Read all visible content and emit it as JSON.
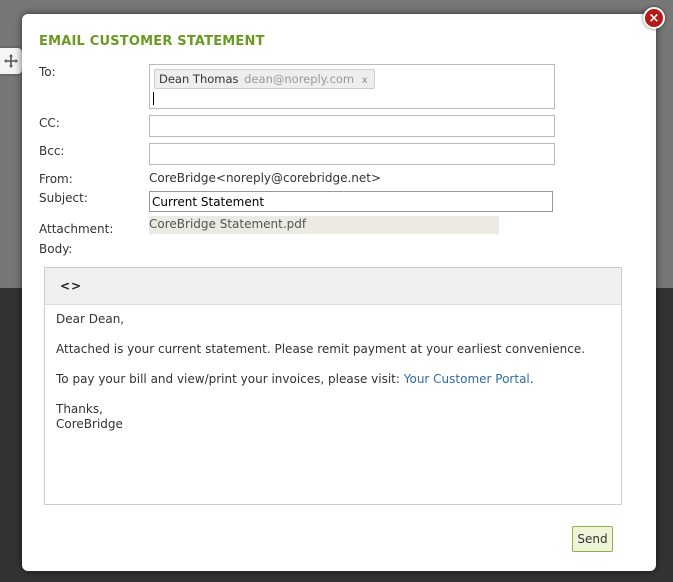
{
  "dialog": {
    "title": "EMAIL CUSTOMER STATEMENT",
    "close_symbol": "×"
  },
  "fields": {
    "to_label": "To:",
    "cc_label": "CC:",
    "bcc_label": "Bcc:",
    "from_label": "From:",
    "subject_label": "Subject:",
    "attachment_label": "Attachment:",
    "body_label": "Body:",
    "to_recipients": [
      {
        "name": "Dean Thomas",
        "email": "dean@noreply.com",
        "remove": "x"
      }
    ],
    "cc_value": "",
    "bcc_value": "",
    "from_value": "CoreBridge<noreply@corebridge.net>",
    "subject_value": "Current Statement",
    "attachment_value": "CoreBridge Statement.pdf"
  },
  "editor": {
    "toolbar": {
      "source_button": "<>"
    },
    "greeting": "Dear Dean,",
    "paragraph1": "Attached is your current statement. Please remit payment at your earliest convenience.",
    "paragraph2_prefix": "To pay your bill and view/print your invoices, please visit: ",
    "portal_link": "Your Customer Portal",
    "paragraph2_suffix": ".",
    "signoff_1": "Thanks,",
    "signoff_2": "CoreBridge"
  },
  "actions": {
    "send_label": "Send"
  },
  "colors": {
    "title_green": "#6a9a1f",
    "close_red": "#b31b1b",
    "link_blue": "#2e6da4",
    "send_border": "#8fb24a"
  },
  "icons": {
    "drag": "move-arrows-icon",
    "close": "close-icon"
  }
}
